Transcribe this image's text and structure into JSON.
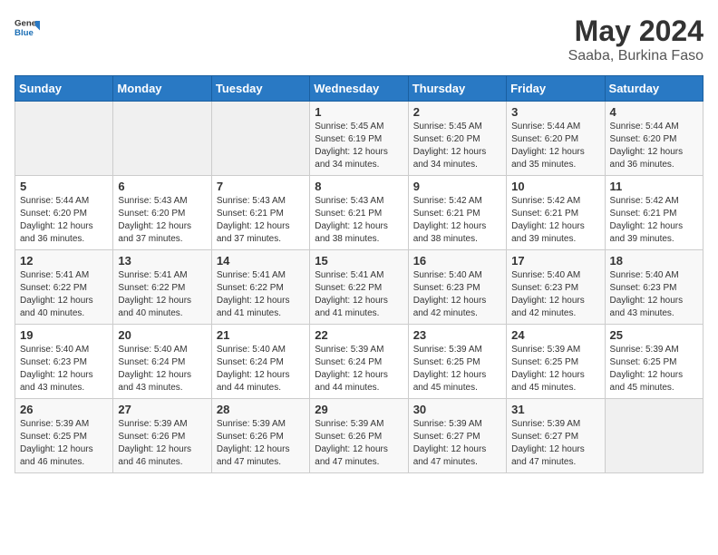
{
  "header": {
    "logo_general": "General",
    "logo_blue": "Blue",
    "title": "May 2024",
    "location": "Saaba, Burkina Faso"
  },
  "days_of_week": [
    "Sunday",
    "Monday",
    "Tuesday",
    "Wednesday",
    "Thursday",
    "Friday",
    "Saturday"
  ],
  "weeks": [
    [
      {
        "day": "",
        "info": ""
      },
      {
        "day": "",
        "info": ""
      },
      {
        "day": "",
        "info": ""
      },
      {
        "day": "1",
        "info": "Sunrise: 5:45 AM\nSunset: 6:19 PM\nDaylight: 12 hours\nand 34 minutes."
      },
      {
        "day": "2",
        "info": "Sunrise: 5:45 AM\nSunset: 6:20 PM\nDaylight: 12 hours\nand 34 minutes."
      },
      {
        "day": "3",
        "info": "Sunrise: 5:44 AM\nSunset: 6:20 PM\nDaylight: 12 hours\nand 35 minutes."
      },
      {
        "day": "4",
        "info": "Sunrise: 5:44 AM\nSunset: 6:20 PM\nDaylight: 12 hours\nand 36 minutes."
      }
    ],
    [
      {
        "day": "5",
        "info": "Sunrise: 5:44 AM\nSunset: 6:20 PM\nDaylight: 12 hours\nand 36 minutes."
      },
      {
        "day": "6",
        "info": "Sunrise: 5:43 AM\nSunset: 6:20 PM\nDaylight: 12 hours\nand 37 minutes."
      },
      {
        "day": "7",
        "info": "Sunrise: 5:43 AM\nSunset: 6:21 PM\nDaylight: 12 hours\nand 37 minutes."
      },
      {
        "day": "8",
        "info": "Sunrise: 5:43 AM\nSunset: 6:21 PM\nDaylight: 12 hours\nand 38 minutes."
      },
      {
        "day": "9",
        "info": "Sunrise: 5:42 AM\nSunset: 6:21 PM\nDaylight: 12 hours\nand 38 minutes."
      },
      {
        "day": "10",
        "info": "Sunrise: 5:42 AM\nSunset: 6:21 PM\nDaylight: 12 hours\nand 39 minutes."
      },
      {
        "day": "11",
        "info": "Sunrise: 5:42 AM\nSunset: 6:21 PM\nDaylight: 12 hours\nand 39 minutes."
      }
    ],
    [
      {
        "day": "12",
        "info": "Sunrise: 5:41 AM\nSunset: 6:22 PM\nDaylight: 12 hours\nand 40 minutes."
      },
      {
        "day": "13",
        "info": "Sunrise: 5:41 AM\nSunset: 6:22 PM\nDaylight: 12 hours\nand 40 minutes."
      },
      {
        "day": "14",
        "info": "Sunrise: 5:41 AM\nSunset: 6:22 PM\nDaylight: 12 hours\nand 41 minutes."
      },
      {
        "day": "15",
        "info": "Sunrise: 5:41 AM\nSunset: 6:22 PM\nDaylight: 12 hours\nand 41 minutes."
      },
      {
        "day": "16",
        "info": "Sunrise: 5:40 AM\nSunset: 6:23 PM\nDaylight: 12 hours\nand 42 minutes."
      },
      {
        "day": "17",
        "info": "Sunrise: 5:40 AM\nSunset: 6:23 PM\nDaylight: 12 hours\nand 42 minutes."
      },
      {
        "day": "18",
        "info": "Sunrise: 5:40 AM\nSunset: 6:23 PM\nDaylight: 12 hours\nand 43 minutes."
      }
    ],
    [
      {
        "day": "19",
        "info": "Sunrise: 5:40 AM\nSunset: 6:23 PM\nDaylight: 12 hours\nand 43 minutes."
      },
      {
        "day": "20",
        "info": "Sunrise: 5:40 AM\nSunset: 6:24 PM\nDaylight: 12 hours\nand 43 minutes."
      },
      {
        "day": "21",
        "info": "Sunrise: 5:40 AM\nSunset: 6:24 PM\nDaylight: 12 hours\nand 44 minutes."
      },
      {
        "day": "22",
        "info": "Sunrise: 5:39 AM\nSunset: 6:24 PM\nDaylight: 12 hours\nand 44 minutes."
      },
      {
        "day": "23",
        "info": "Sunrise: 5:39 AM\nSunset: 6:25 PM\nDaylight: 12 hours\nand 45 minutes."
      },
      {
        "day": "24",
        "info": "Sunrise: 5:39 AM\nSunset: 6:25 PM\nDaylight: 12 hours\nand 45 minutes."
      },
      {
        "day": "25",
        "info": "Sunrise: 5:39 AM\nSunset: 6:25 PM\nDaylight: 12 hours\nand 45 minutes."
      }
    ],
    [
      {
        "day": "26",
        "info": "Sunrise: 5:39 AM\nSunset: 6:25 PM\nDaylight: 12 hours\nand 46 minutes."
      },
      {
        "day": "27",
        "info": "Sunrise: 5:39 AM\nSunset: 6:26 PM\nDaylight: 12 hours\nand 46 minutes."
      },
      {
        "day": "28",
        "info": "Sunrise: 5:39 AM\nSunset: 6:26 PM\nDaylight: 12 hours\nand 47 minutes."
      },
      {
        "day": "29",
        "info": "Sunrise: 5:39 AM\nSunset: 6:26 PM\nDaylight: 12 hours\nand 47 minutes."
      },
      {
        "day": "30",
        "info": "Sunrise: 5:39 AM\nSunset: 6:27 PM\nDaylight: 12 hours\nand 47 minutes."
      },
      {
        "day": "31",
        "info": "Sunrise: 5:39 AM\nSunset: 6:27 PM\nDaylight: 12 hours\nand 47 minutes."
      },
      {
        "day": "",
        "info": ""
      }
    ]
  ]
}
